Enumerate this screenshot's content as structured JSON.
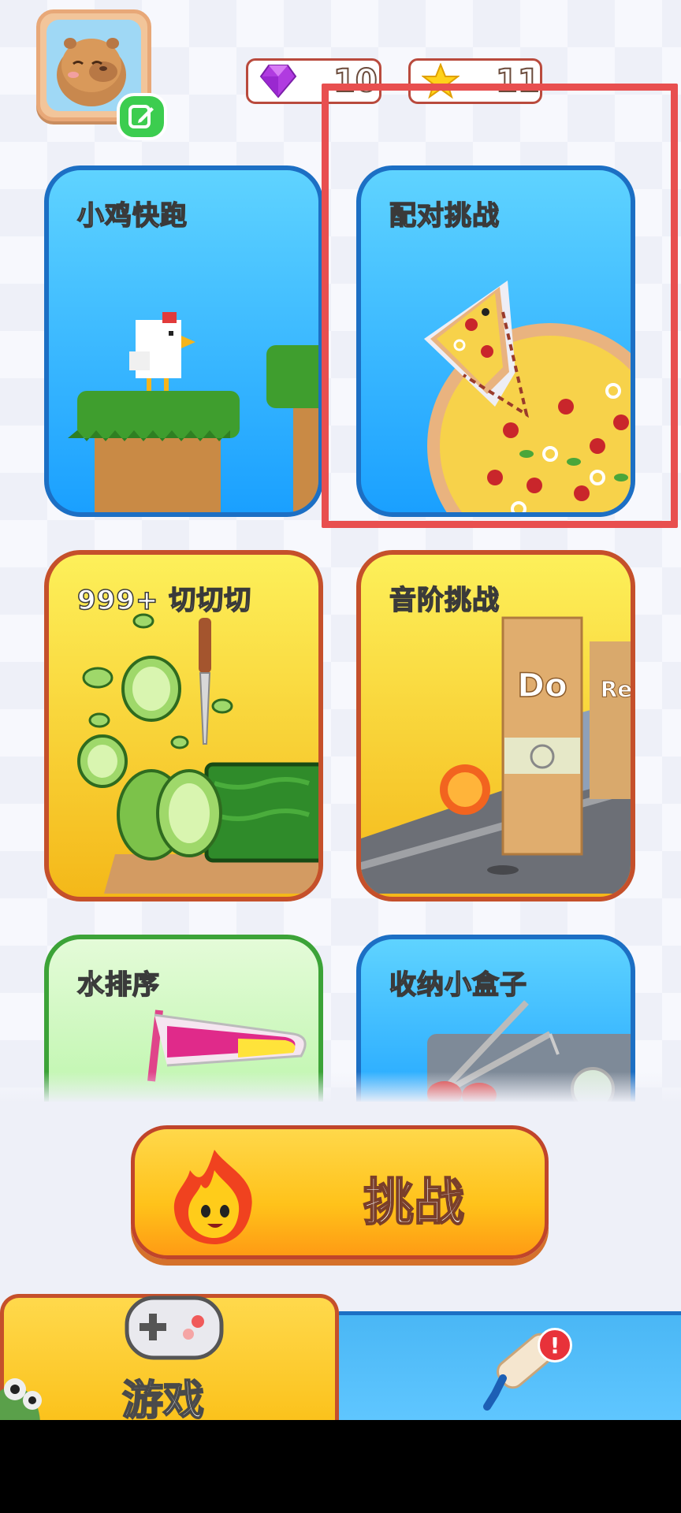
{
  "currency": {
    "gems": "10",
    "stars": "11"
  },
  "cards": {
    "chick_run": {
      "title": "小鸡快跑"
    },
    "match_challenge": {
      "title": "配对挑战"
    },
    "cut": {
      "title": "999+ 切切切"
    },
    "scale_challenge": {
      "title": "音阶挑战",
      "door1": "Do",
      "door2": "Re"
    },
    "water_sort": {
      "title": "水排序"
    },
    "storage_box": {
      "title": "收纳小盒子"
    }
  },
  "challenge_button": {
    "label": "挑战"
  },
  "nav": {
    "games_label": "游戏",
    "notification_badge": "!"
  },
  "colors": {
    "highlight": "#e84f4f",
    "accent_yellow": "#ffc21a",
    "accent_blue": "#1aa0ff"
  }
}
